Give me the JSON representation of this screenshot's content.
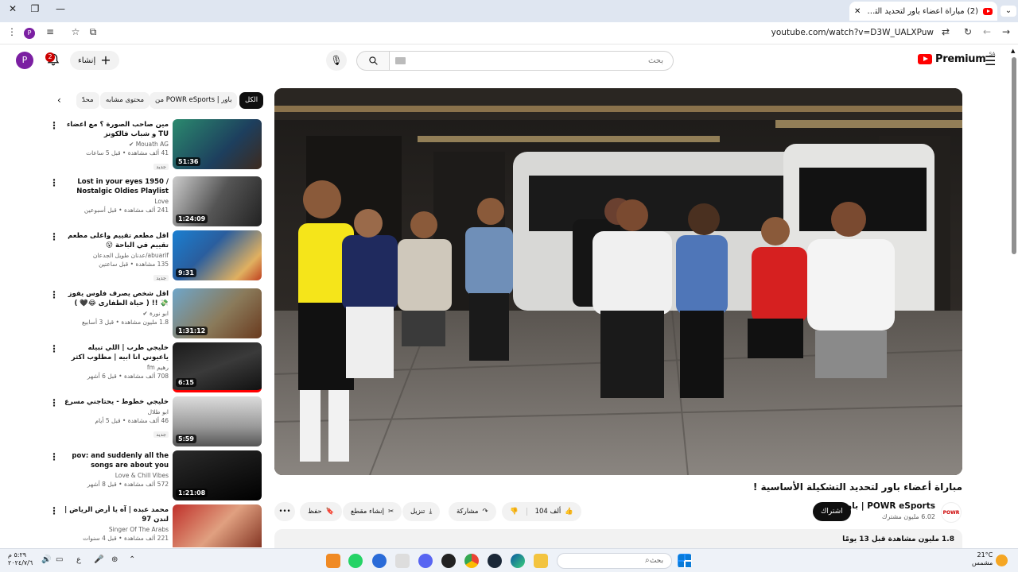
{
  "browser": {
    "tab_title": "(2) مباراة أعضاء باور لتحديد التشك",
    "url": "youtube.com/watch?v=D3W_UALXPuw",
    "profile_initial": "P"
  },
  "header": {
    "avatar_initial": "P",
    "notif_count": "2",
    "create_label": "إنشاء",
    "search_placeholder": "بحث",
    "logo_text": "Premium",
    "region": "SA"
  },
  "chips": [
    {
      "label": "الكل",
      "active": true
    },
    {
      "label": "من POWR eSports | باور",
      "active": false
    },
    {
      "label": "محتوى مشابه",
      "active": false
    },
    {
      "label": "محدّ",
      "active": false
    }
  ],
  "sidebar": [
    {
      "title": "مين صاحب الصورة ؟ مع اعضاء TU و شباب فالكونز",
      "channel": "Mouath AG ✔",
      "meta": "41 ألف مشاهدة • قبل 5 ساعات",
      "badge": "جديد",
      "duration": "51:36"
    },
    {
      "title": "Lost in your eyes 1950 / Nostalgic Oldies Playlist -1950s",
      "channel": "Love",
      "meta": "241 ألف مشاهدة • قبل أسبوعين",
      "badge": "",
      "duration": "1:24:09"
    },
    {
      "title": "اقل مطعم تقييم واعلى مطعم تقييم في الباحة 😮",
      "channel": "abuarif/عدنان طويل الجدعان",
      "meta": "135 مشاهدة • قبل ساعتين",
      "badge": "جديد",
      "duration": "9:31"
    },
    {
      "title": "اقل شخص يصرف فلوس يفوز 💸 !! ( حياة الطفارى 😂🖤 )",
      "channel": "ابو نورة ✔",
      "meta": "1.8 مليون مشاهدة • قبل 3 أسابيع",
      "badge": "",
      "duration": "1:31:12"
    },
    {
      "title": "خليجي طرب | اللي تبيله ياعيوني انا ابيه | مطلوب اكثر شيء .",
      "channel": "رهيم fm",
      "meta": "708 ألف مشاهدة • قبل 6 أشهر",
      "badge": "",
      "duration": "6:15"
    },
    {
      "title": "خليجي خطوط - يحتاجني مسرع",
      "channel": "ابو طلال",
      "meta": "46 ألف مشاهدة • قبل 5 أيام",
      "badge": "جديد",
      "duration": "5:59"
    },
    {
      "title": "pov: and suddenly all the songs are about you [playlist] - Love...",
      "channel": "Love & Chill Vibes",
      "meta": "572 ألف مشاهدة • قبل 8 أشهر",
      "badge": "",
      "duration": "1:21:08"
    },
    {
      "title": "محمد عبده | آه يا أرض الرياض | لندن 97",
      "channel": "Singer Of The Arabs",
      "meta": "221 ألف مشاهدة • قبل 4 سنوات",
      "badge": "",
      "duration": ""
    }
  ],
  "video": {
    "title": "مباراة أعضاء باور لتحديد التشكيلة الأساسية !",
    "channel": "POWR eSports | باور",
    "subscribers": "6.02 مليون مشترك",
    "subscribe_label": "اشتراك",
    "likes": "104 ألف",
    "share_label": "مشاركة",
    "download_label": "تنزيل",
    "clip_label": "إنشاء مقطع",
    "save_label": "حفظ",
    "views_meta": "1.8 مليون مشاهدة  قبل 13 يومًا"
  },
  "taskbar": {
    "search_placeholder": "بحث",
    "weather_temp": "21°C",
    "weather_desc": "مشمس",
    "time": "٥:٢٩ م",
    "date": "٢٠٢٤/٧/٦",
    "lang": "ع"
  }
}
